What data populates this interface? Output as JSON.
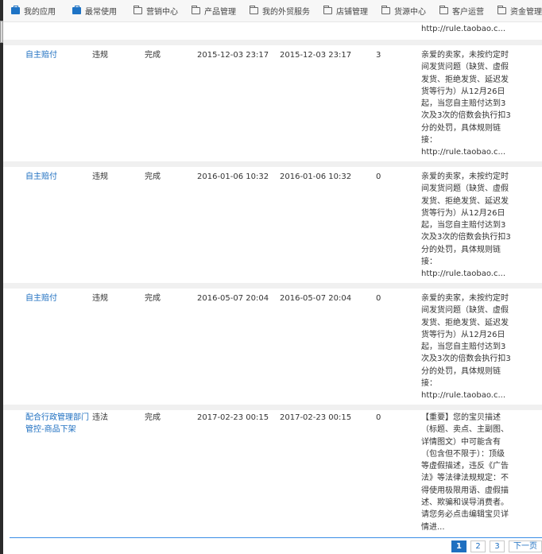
{
  "nav": {
    "my_apps": "我的应用",
    "frequent": "最常使用",
    "items": [
      "营销中心",
      "产品管理",
      "我的外贸服务",
      "店铺管理",
      "货源中心",
      "客户运营",
      "资金管理"
    ]
  },
  "first_row_tail": "http://rule.taobao.c...",
  "rows": [
    {
      "name": "自主赔付",
      "type": "违规",
      "status": "完成",
      "start": "2015-12-03 23:17",
      "end": "2015-12-03 23:17",
      "count": "3",
      "desc": [
        "亲爱的卖家，未按约定时",
        "间发货问题（缺货、虚假",
        "发货、拒绝发货、延迟发",
        "货等行为）从12月26日",
        "起，当您自主赔付达到3",
        "次及3次的倍数会执行扣3",
        "分的处罚，具体规则链",
        "接：",
        "http://rule.taobao.c..."
      ]
    },
    {
      "name": "自主赔付",
      "type": "违规",
      "status": "完成",
      "start": "2016-01-06 10:32",
      "end": "2016-01-06 10:32",
      "count": "0",
      "desc": [
        "亲爱的卖家，未按约定时",
        "间发货问题（缺货、虚假",
        "发货、拒绝发货、延迟发",
        "货等行为）从12月26日",
        "起，当您自主赔付达到3",
        "次及3次的倍数会执行扣3",
        "分的处罚，具体规则链",
        "接：",
        "http://rule.taobao.c..."
      ]
    },
    {
      "name": "自主赔付",
      "type": "违规",
      "status": "完成",
      "start": "2016-05-07 20:04",
      "end": "2016-05-07 20:04",
      "count": "0",
      "desc": [
        "亲爱的卖家，未按约定时",
        "间发货问题（缺货、虚假",
        "发货、拒绝发货、延迟发",
        "货等行为）从12月26日",
        "起，当您自主赔付达到3",
        "次及3次的倍数会执行扣3",
        "分的处罚，具体规则链",
        "接：",
        "http://rule.taobao.c..."
      ]
    },
    {
      "name_lines": [
        "配合行政管理部门",
        "管控-商品下架"
      ],
      "type": "违法",
      "status": "完成",
      "start": "2017-02-23 00:15",
      "end": "2017-02-23 00:15",
      "count": "0",
      "desc": [
        "【重要】您的宝贝描述",
        "（标题、卖点、主副图、",
        "详情图文）中可能含有",
        "（包含但不限于）：顶级",
        "等虚假描述，违反《广告",
        "法》等法律法规规定：不",
        "得使用极限用语、虚假描",
        "述、欺骗和误导消费者。",
        "请您务必点击编辑宝贝详",
        "情进..."
      ]
    }
  ],
  "pager": {
    "pages": [
      "1",
      "2",
      "3"
    ],
    "next": "下一页",
    "current": "1"
  }
}
